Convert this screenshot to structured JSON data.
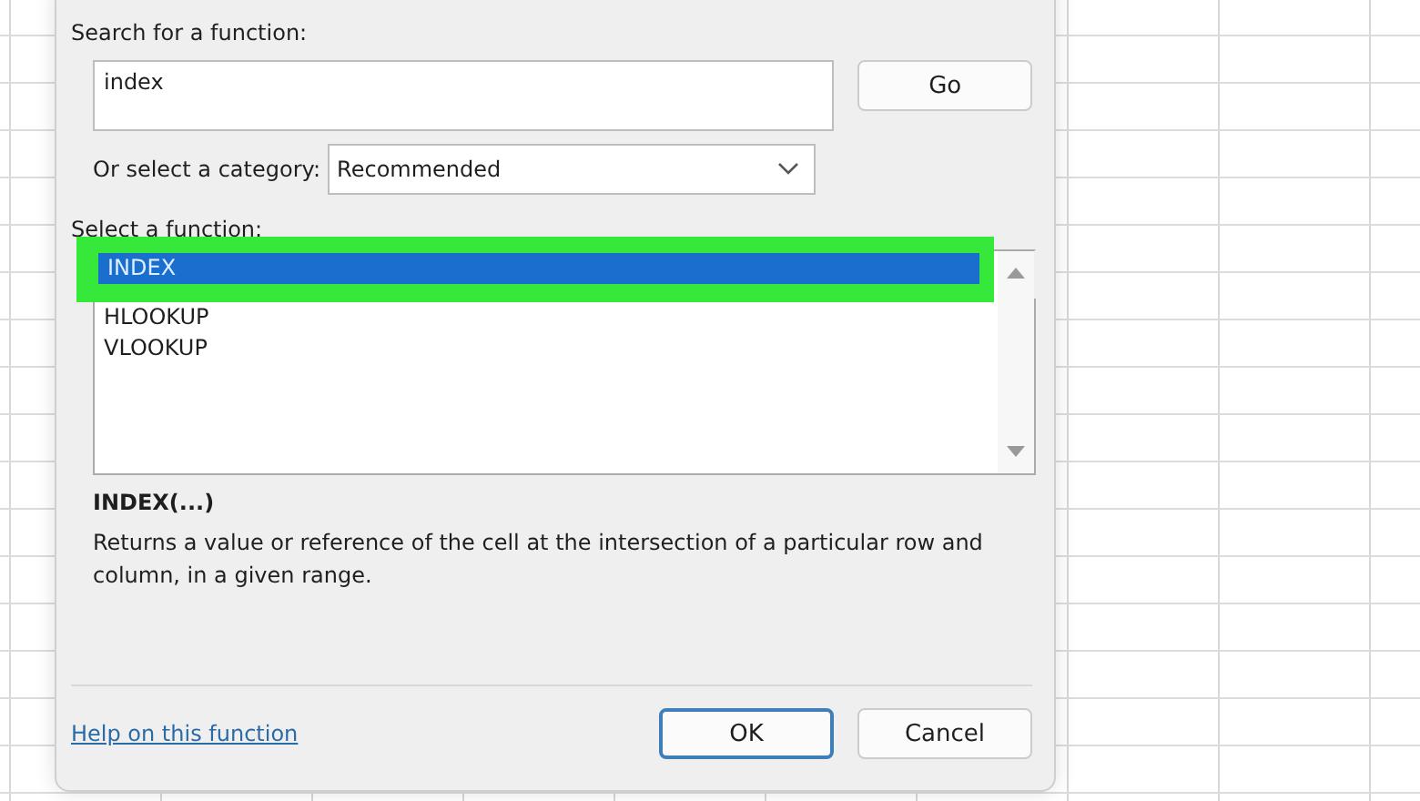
{
  "dialog": {
    "search_label": "Search for a function:",
    "search_field": {
      "value": "index"
    },
    "go_button": "Go",
    "category_label": "Or select a category:",
    "category_dropdown": {
      "value": "Recommended"
    },
    "function_label": "Select a function:",
    "functions": [
      {
        "name": "INDEX",
        "selected": true,
        "highlighted": true
      },
      {
        "name": "HLOOKUP",
        "selected": false,
        "highlighted": false
      },
      {
        "name": "VLOOKUP",
        "selected": false,
        "highlighted": false
      }
    ],
    "signature": "INDEX(...)",
    "description": "Returns a value or reference of the cell at the intersection of a particular row and column, in a given range.",
    "help_link": "Help on this function",
    "buttons": [
      {
        "label": "OK",
        "default": true
      },
      {
        "label": "Cancel",
        "default": false
      }
    ]
  }
}
